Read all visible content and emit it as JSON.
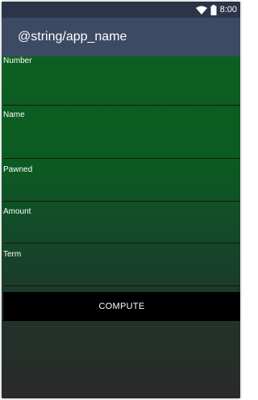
{
  "status_bar": {
    "time": "8:00",
    "icons": [
      "wifi-icon",
      "battery-icon"
    ]
  },
  "app_bar": {
    "title": "@string/app_name"
  },
  "form": {
    "fields": [
      {
        "label": "Number",
        "value": ""
      },
      {
        "label": "Name",
        "value": ""
      },
      {
        "label": "Pawned",
        "value": ""
      },
      {
        "label": "Amount",
        "value": ""
      },
      {
        "label": "Term",
        "value": ""
      }
    ],
    "compute_label": "COMPUTE"
  },
  "colors": {
    "status_bar": "#2c3447",
    "app_bar": "#3d4a63",
    "form_background_top": "#0c5f22",
    "button_background": "#000000",
    "text": "#ffffff"
  }
}
